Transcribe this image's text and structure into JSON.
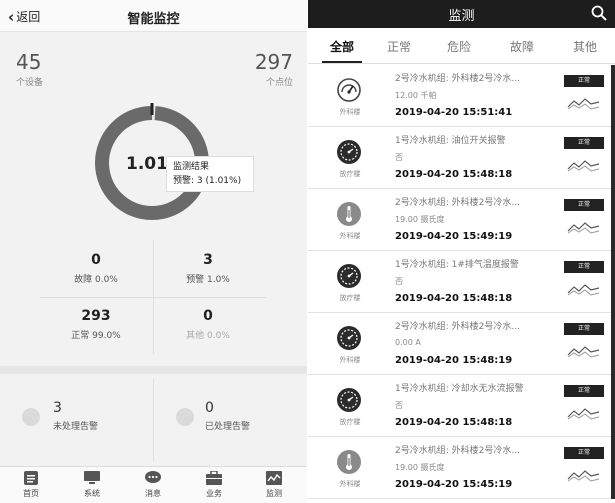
{
  "left": {
    "header": {
      "back_label": "返回",
      "title": "智能监控"
    },
    "summary": {
      "devices_count": "45",
      "devices_label": "个设备",
      "points_count": "297",
      "points_label": "个点位"
    },
    "donut": {
      "center_text": "1.01",
      "fraction_normal": 0.99,
      "tooltip_title": "监测结果",
      "tooltip_text": "预警: 3 (1.01%)"
    },
    "stats": [
      {
        "value": "0",
        "label": "故障 0.0%"
      },
      {
        "value": "3",
        "label": "预警 1.0%"
      },
      {
        "value": "293",
        "label": "正常 99.0%"
      },
      {
        "value": "0",
        "label": "其他 0.0%"
      }
    ],
    "alerts": [
      {
        "value": "3",
        "label": "未处理告警"
      },
      {
        "value": "0",
        "label": "已处理告警"
      }
    ],
    "tabbar": [
      {
        "icon": "list-icon",
        "label": "首页"
      },
      {
        "icon": "monitor-icon",
        "label": "系统"
      },
      {
        "icon": "chat-icon",
        "label": "消息"
      },
      {
        "icon": "briefcase-icon",
        "label": "业务"
      },
      {
        "icon": "chart-icon",
        "label": "监测"
      }
    ]
  },
  "right": {
    "header": {
      "title": "监测"
    },
    "tabs": [
      "全部",
      "正常",
      "危险",
      "故障",
      "其他"
    ],
    "active_tab": 0,
    "rows": [
      {
        "icon": "gauge-icon",
        "type": "外科楼",
        "title": "2号冷水机组: 外科楼2号冷水...",
        "value": "12.00 千帕",
        "time": "2019-04-20 15:51:41",
        "status": "正常"
      },
      {
        "icon": "dial-icon",
        "type": "放疗楼",
        "title": "1号冷水机组: 油位开关报警",
        "value": "否",
        "time": "2019-04-20 15:48:18",
        "status": "正常"
      },
      {
        "icon": "thermometer-icon",
        "type": "外科楼",
        "title": "2号冷水机组: 外科楼2号冷水...",
        "value": "19.00 摄氏度",
        "time": "2019-04-20 15:49:19",
        "status": "正常"
      },
      {
        "icon": "dial-icon",
        "type": "放疗楼",
        "title": "1号冷水机组: 1#排气温度报警",
        "value": "否",
        "time": "2019-04-20 15:48:18",
        "status": "正常"
      },
      {
        "icon": "dial-icon",
        "type": "外科楼",
        "title": "2号冷水机组: 外科楼2号冷水...",
        "value": "0.00 A",
        "time": "2019-04-20 15:48:19",
        "status": "正常"
      },
      {
        "icon": "dial-icon",
        "type": "放疗楼",
        "title": "1号冷水机组: 冷却水无水流报警",
        "value": "否",
        "time": "2019-04-20 15:48:18",
        "status": "正常"
      },
      {
        "icon": "thermometer-icon",
        "type": "外科楼",
        "title": "2号冷水机组: 外科楼2号冷水...",
        "value": "19.00 摄氏度",
        "time": "2019-04-20 15:45:19",
        "status": "正常"
      }
    ]
  }
}
